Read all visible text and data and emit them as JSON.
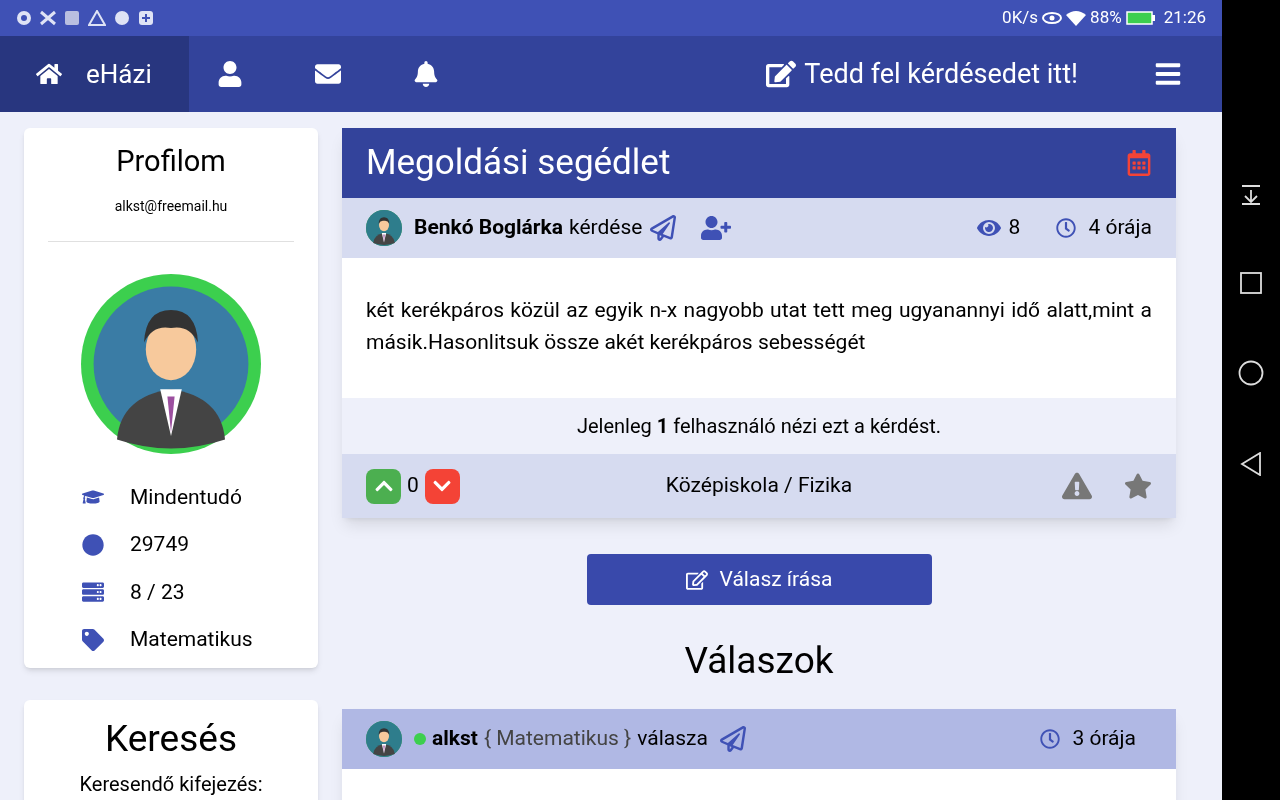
{
  "status_bar": {
    "speed": "0K/s",
    "battery": "88%",
    "time": "21:26"
  },
  "nav": {
    "items": [
      {
        "label": "eHázi",
        "selected": true
      },
      {
        "selected": false
      },
      {
        "selected": false
      },
      {
        "selected": false
      }
    ],
    "ask": "Tedd fel kérdésedet itt!"
  },
  "profile": {
    "title": "Profilom",
    "email": "alkst@freemail.hu",
    "online": true,
    "stats": [
      "Mindentudó",
      "29749",
      "8 / 23",
      "Matematikus"
    ]
  },
  "search": {
    "title": "Keresés",
    "label": "Keresendő kifejezés:"
  },
  "question": {
    "title": "Megoldási segédlet",
    "author": "Benkó Boglárka",
    "suffix": "kérdése",
    "views": "8",
    "time": "4 órája",
    "text": "két kerékpáros közül az egyik n-x nagyobb utat tett meg ugyanannyi idő alatt,mint a másik.Hasonlitsuk össze akét kerékpáros sebességét",
    "viewers": "Jelenleg **1** felhasználó nézi ezt a kérdést.",
    "score": "0",
    "category": "Középiskola / Fizika"
  },
  "answer_button": "Válasz írása",
  "answers_title": "Válaszok",
  "answers": [
    {
      "author": "alkst",
      "online": true,
      "rank": "{ Matematikus }",
      "suffix": "válasza",
      "time": "3 órája"
    }
  ]
}
